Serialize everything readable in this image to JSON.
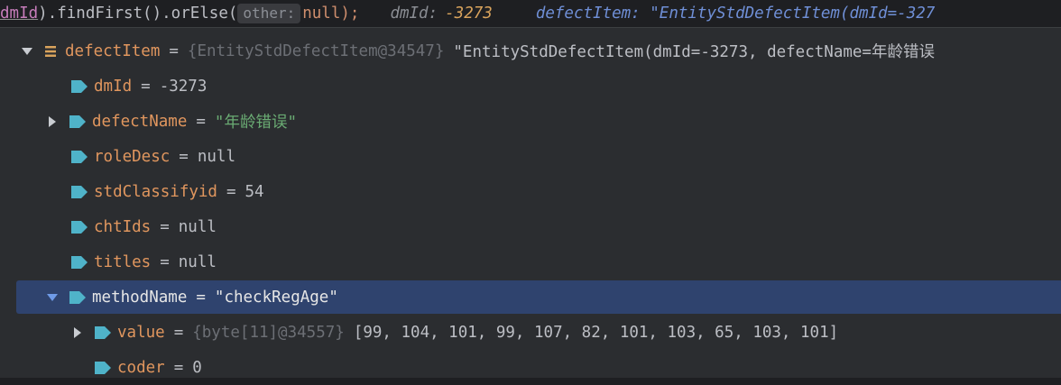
{
  "code_line": {
    "underlined_token": "dmId",
    "before_hint": ").findFirst().orElse(",
    "param_hint": "other:",
    "after_hint": "null);",
    "hint1_label": "dmId:",
    "hint1_value": "-3273",
    "hint2": "defectItem: \"EntityStdDefectItem(dmId=-327"
  },
  "tree": [
    {
      "name": "defectItem",
      "ref": "{EntityStdDefectItem@34547}",
      "value": "\"EntityStdDefectItem(dmId=-3273, defectName=年龄错误",
      "kind": "object",
      "expand": "expanded"
    },
    {
      "name": "dmId",
      "value": "-3273",
      "kind": "field",
      "expand": "none"
    },
    {
      "name": "defectName",
      "value": "\"年龄错误\"",
      "kind": "field-string",
      "expand": "collapsed"
    },
    {
      "name": "roleDesc",
      "value": "null",
      "kind": "field",
      "expand": "none"
    },
    {
      "name": "stdClassifyid",
      "value": "54",
      "kind": "field",
      "expand": "none"
    },
    {
      "name": "chtIds",
      "value": "null",
      "kind": "field",
      "expand": "none"
    },
    {
      "name": "titles",
      "value": "null",
      "kind": "field",
      "expand": "none"
    },
    {
      "name": "methodName",
      "value": "\"checkRegAge\"",
      "kind": "field",
      "expand": "expanded",
      "selected": true
    },
    {
      "name": "value",
      "ref": "{byte[11]@34557}",
      "value": "[99, 104, 101, 99, 107, 82, 101, 103, 65, 103, 101]",
      "kind": "field",
      "expand": "collapsed"
    },
    {
      "name": "coder",
      "value": "0",
      "kind": "field",
      "expand": "none"
    }
  ],
  "equals_sign": "=",
  "icons": {
    "expanded": "chevron-down-icon",
    "collapsed": "chevron-right-icon",
    "object": "list-icon",
    "field": "field-tag-icon"
  },
  "colors": {
    "field_name": "#e0965e",
    "string_value": "#6aab73",
    "selection": "#2f436e",
    "tag_icon": "#4fb3c9"
  }
}
